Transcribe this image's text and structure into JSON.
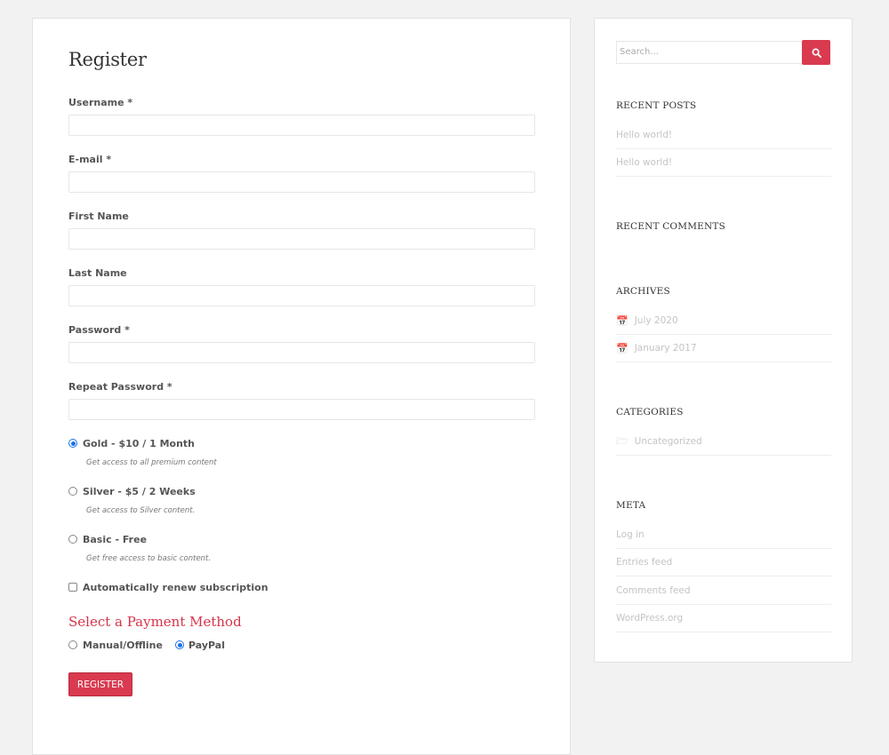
{
  "form": {
    "title": "Register",
    "fields": [
      {
        "label": "Username *",
        "value": ""
      },
      {
        "label": "E-mail *",
        "value": ""
      },
      {
        "label": "First Name",
        "value": ""
      },
      {
        "label": "Last Name",
        "value": ""
      },
      {
        "label": "Password *",
        "value": ""
      },
      {
        "label": "Repeat Password *",
        "value": ""
      }
    ],
    "plans": [
      {
        "label": "Gold - $10 / 1 Month",
        "description": "Get access to all premium content",
        "selected": true
      },
      {
        "label": "Silver - $5 / 2 Weeks",
        "description": "Get access to Silver content.",
        "selected": false
      },
      {
        "label": "Basic - Free",
        "description": "Get free access to basic content.",
        "selected": false
      }
    ],
    "auto_renew": {
      "label": "Automatically renew subscription",
      "checked": false
    },
    "payment": {
      "title": "Select a Payment Method",
      "options": [
        {
          "label": "Manual/Offline",
          "selected": false
        },
        {
          "label": "PayPal",
          "selected": true
        }
      ]
    },
    "submit_label": "REGISTER"
  },
  "sidebar": {
    "search": {
      "placeholder": "Search...",
      "icon": "search-icon"
    },
    "recent_posts": {
      "title": "RECENT POSTS",
      "items": [
        "Hello world!",
        "Hello world!"
      ]
    },
    "recent_comments": {
      "title": "RECENT COMMENTS",
      "items": []
    },
    "archives": {
      "title": "ARCHIVES",
      "icon": "calendar-icon",
      "items": [
        "July 2020",
        "January 2017"
      ]
    },
    "categories": {
      "title": "CATEGORIES",
      "icon": "folder-icon",
      "items": [
        "Uncategorized"
      ]
    },
    "meta": {
      "title": "META",
      "items": [
        "Log in",
        "Entries feed",
        "Comments feed",
        "WordPress.org"
      ]
    }
  },
  "colors": {
    "accent": "#d93a50",
    "radio_checked": "#1a73e8"
  }
}
